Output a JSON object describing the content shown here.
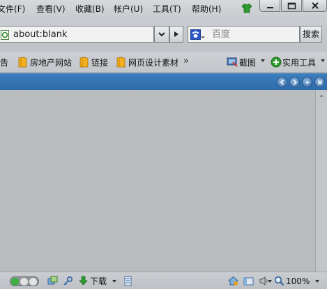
{
  "menu": {
    "items": [
      "文件(F)",
      "查看(V)",
      "收藏(B)",
      "帐户(U)",
      "工具(T)",
      "帮助(H)"
    ]
  },
  "address": {
    "url": "about:blank"
  },
  "search": {
    "engine_icon": "baidu-paw-icon",
    "placeholder": "百度",
    "button_label": "搜索"
  },
  "favorites": {
    "items": [
      {
        "label": "报告",
        "icon": "folder-icon"
      },
      {
        "label": "房地产网站",
        "icon": "folder-icon"
      },
      {
        "label": "链接",
        "icon": "folder-icon"
      },
      {
        "label": "网页设计素材",
        "icon": "folder-icon"
      }
    ],
    "more_label": "»",
    "screenshot_label": "截图",
    "tools_label": "实用工具"
  },
  "statusbar": {
    "download_label": "下载",
    "zoom": "100%"
  },
  "colors": {
    "tab_strip": "#3574b3",
    "background": "#b9bcbf",
    "accent_green": "#2e9b2e"
  }
}
